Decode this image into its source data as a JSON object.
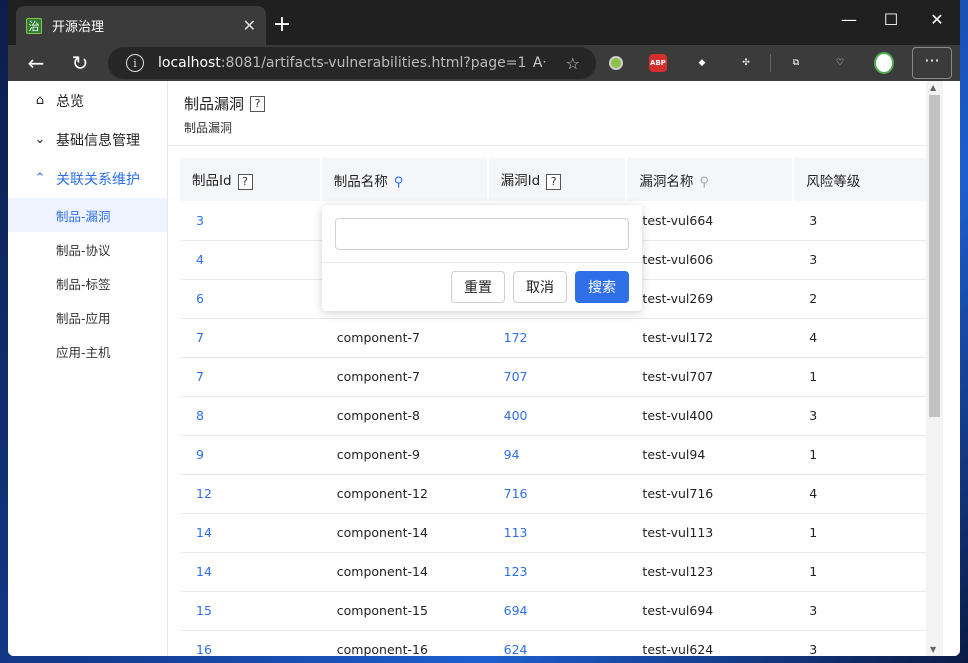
{
  "browser": {
    "tab_title": "开源治理",
    "tab_favicon": "治",
    "url_host": "localhost",
    "url_rest": ":8081/artifacts-vulnerabilities.html?page=1",
    "ext_abp": "ABP"
  },
  "sidebar": {
    "items": [
      {
        "label": "总览",
        "icon": "home-icon"
      },
      {
        "label": "基础信息管理",
        "icon": "chevron-down-icon"
      },
      {
        "label": "关联关系维护",
        "icon": "chevron-up-icon"
      }
    ],
    "subitems": [
      {
        "label": "制品-漏洞"
      },
      {
        "label": "制品-协议"
      },
      {
        "label": "制品-标签"
      },
      {
        "label": "制品-应用"
      },
      {
        "label": "应用-主机"
      }
    ]
  },
  "page": {
    "title": "制品漏洞",
    "subtitle": "制品漏洞",
    "help": "?"
  },
  "table": {
    "headers": [
      "制品Id",
      "制品名称",
      "漏洞Id",
      "漏洞名称",
      "风险等级"
    ],
    "rows": [
      [
        "3",
        "",
        "",
        "test-vul664",
        "3"
      ],
      [
        "4",
        "",
        "",
        "test-vul606",
        "3"
      ],
      [
        "6",
        "",
        "",
        "test-vul269",
        "2"
      ],
      [
        "7",
        "component-7",
        "172",
        "test-vul172",
        "4"
      ],
      [
        "7",
        "component-7",
        "707",
        "test-vul707",
        "1"
      ],
      [
        "8",
        "component-8",
        "400",
        "test-vul400",
        "3"
      ],
      [
        "9",
        "component-9",
        "94",
        "test-vul94",
        "1"
      ],
      [
        "12",
        "component-12",
        "716",
        "test-vul716",
        "4"
      ],
      [
        "14",
        "component-14",
        "113",
        "test-vul113",
        "1"
      ],
      [
        "14",
        "component-14",
        "123",
        "test-vul123",
        "1"
      ],
      [
        "15",
        "component-15",
        "694",
        "test-vul694",
        "3"
      ],
      [
        "16",
        "component-16",
        "624",
        "test-vul624",
        "3"
      ]
    ]
  },
  "filter_popup": {
    "input_value": "",
    "reset_label": "重置",
    "cancel_label": "取消",
    "search_label": "搜索"
  },
  "colors": {
    "accent": "#2f6fe8",
    "titlebar": "#202020",
    "toolbar": "#3b3b3b"
  }
}
